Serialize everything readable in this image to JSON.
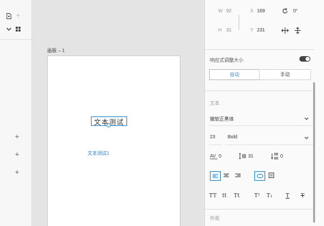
{
  "canvas": {
    "artboard_label": "画板 – 1",
    "selected_text": "文本测试",
    "text_2": "文本测试1"
  },
  "transform": {
    "w_label": "W",
    "w_value": "92",
    "x_label": "X",
    "x_value": "169",
    "rotation_value": "0°",
    "h_label": "H",
    "h_value": "31",
    "y_label": "Y",
    "y_value": "231"
  },
  "responsive": {
    "label": "响应式调整大小",
    "toggle_on": true,
    "auto_label": "自动",
    "manual_label": "手动"
  },
  "text": {
    "section_label": "文本",
    "font_family": "微软正黑体",
    "font_size": "23",
    "font_weight": "Bold",
    "char_spacing": "0",
    "line_spacing": "31",
    "para_spacing": "0",
    "type_buttons": [
      "TT",
      "tt",
      "Tt",
      "T¹",
      "T₁",
      "T",
      "T"
    ]
  },
  "appearance": {
    "section_label": "外观"
  },
  "colors": {
    "accent": "#2f8fd6",
    "toggle": "#444444"
  }
}
